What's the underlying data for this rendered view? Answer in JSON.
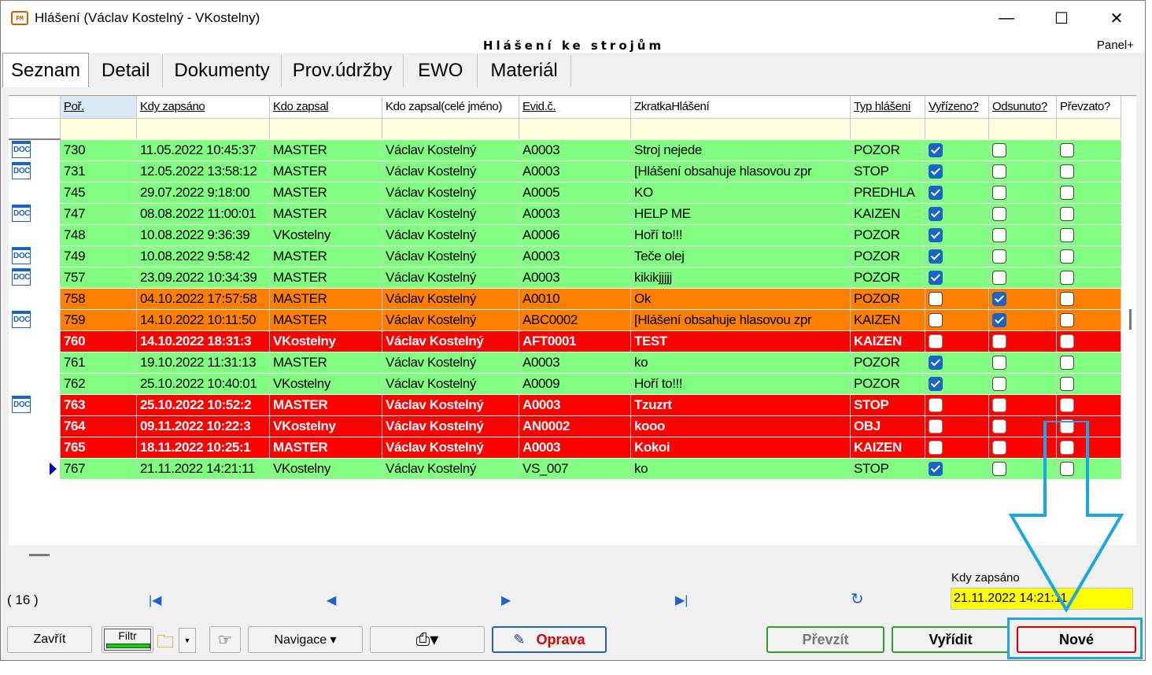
{
  "window": {
    "title": "Hlášení (Václav Kostelný - VKostelny)",
    "app_icon_text": "РМ",
    "module_title": "Hlášení ke strojům",
    "panel_link": "Panel+"
  },
  "tabs": [
    {
      "label": "Seznam",
      "active": true
    },
    {
      "label": "Detail"
    },
    {
      "label": "Dokumenty"
    },
    {
      "label": "Prov.údržby"
    },
    {
      "label": "EWO"
    },
    {
      "label": "Materiál"
    }
  ],
  "grid": {
    "columns": [
      "Poř.",
      "Kdy zapsáno",
      "Kdo zapsal",
      "Kdo zapsal(celé jméno)",
      "Evid.č.",
      "ZkratkaHlášení",
      "Typ hlášení",
      "Vyřízeno?",
      "Odsunuto?",
      "Převzato?"
    ],
    "doc_icon_text": "DOC",
    "rows": [
      {
        "por": "730",
        "kdy": "11.05.2022 10:45:37",
        "kdo": "MASTER",
        "jmeno": "Václav Kostelný",
        "evid": "A0003",
        "zkratka": "Stroj nejede",
        "typ": "POZOR",
        "vyrizeno": true,
        "odsunuto": false,
        "prevzato": false,
        "color": "green",
        "doc": true
      },
      {
        "por": "731",
        "kdy": "12.05.2022 13:58:12",
        "kdo": "MASTER",
        "jmeno": "Václav Kostelný",
        "evid": "A0003",
        "zkratka": "[Hlášení obsahuje hlasovou zpr",
        "typ": "STOP",
        "vyrizeno": true,
        "odsunuto": false,
        "prevzato": false,
        "color": "green",
        "doc": true
      },
      {
        "por": "745",
        "kdy": "29.07.2022 9:18:00",
        "kdo": "MASTER",
        "jmeno": "Václav Kostelný",
        "evid": "A0005",
        "zkratka": "KO",
        "typ": "PREDHLA",
        "vyrizeno": true,
        "odsunuto": false,
        "prevzato": false,
        "color": "green",
        "doc": false
      },
      {
        "por": "747",
        "kdy": "08.08.2022 11:00:01",
        "kdo": "MASTER",
        "jmeno": "Václav Kostelný",
        "evid": "A0003",
        "zkratka": "HELP ME",
        "typ": "KAIZEN",
        "vyrizeno": true,
        "odsunuto": false,
        "prevzato": false,
        "color": "green",
        "doc": true
      },
      {
        "por": "748",
        "kdy": "10.08.2022 9:36:39",
        "kdo": "VKostelny",
        "jmeno": "Václav Kostelný",
        "evid": "A0006",
        "zkratka": "Hoří to!!!",
        "typ": "POZOR",
        "vyrizeno": true,
        "odsunuto": false,
        "prevzato": false,
        "color": "green",
        "doc": false
      },
      {
        "por": "749",
        "kdy": "10.08.2022 9:58:42",
        "kdo": "MASTER",
        "jmeno": "Václav Kostelný",
        "evid": "A0003",
        "zkratka": "Teče olej",
        "typ": "POZOR",
        "vyrizeno": true,
        "odsunuto": false,
        "prevzato": false,
        "color": "green",
        "doc": true
      },
      {
        "por": "757",
        "kdy": "23.09.2022 10:34:39",
        "kdo": "MASTER",
        "jmeno": "Václav Kostelný",
        "evid": "A0003",
        "zkratka": "kikikjjjjj",
        "typ": "POZOR",
        "vyrizeno": true,
        "odsunuto": false,
        "prevzato": false,
        "color": "green",
        "doc": true
      },
      {
        "por": "758",
        "kdy": "04.10.2022 17:57:58",
        "kdo": "MASTER",
        "jmeno": "Václav Kostelný",
        "evid": "A0010",
        "zkratka": "Ok",
        "typ": "POZOR",
        "vyrizeno": false,
        "odsunuto": true,
        "prevzato": false,
        "color": "orange",
        "doc": false
      },
      {
        "por": "759",
        "kdy": "14.10.2022 10:11:50",
        "kdo": "MASTER",
        "jmeno": "Václav Kostelný",
        "evid": "ABC0002",
        "zkratka": "[Hlášení obsahuje hlasovou zpr",
        "typ": "KAIZEN",
        "vyrizeno": false,
        "odsunuto": true,
        "prevzato": false,
        "color": "orange",
        "doc": true
      },
      {
        "por": "760",
        "kdy": "14.10.2022 18:31:3",
        "kdo": "VKostelny",
        "jmeno": "Václav Kostelný",
        "evid": "AFT0001",
        "zkratka": "TEST",
        "typ": "KAIZEN",
        "vyrizeno": false,
        "odsunuto": false,
        "prevzato": false,
        "color": "red",
        "doc": false
      },
      {
        "por": "761",
        "kdy": "19.10.2022 11:31:13",
        "kdo": "MASTER",
        "jmeno": "Václav Kostelný",
        "evid": "A0003",
        "zkratka": "ko",
        "typ": "POZOR",
        "vyrizeno": true,
        "odsunuto": false,
        "prevzato": false,
        "color": "green",
        "doc": false
      },
      {
        "por": "762",
        "kdy": "25.10.2022 10:40:01",
        "kdo": "VKostelny",
        "jmeno": "Václav Kostelný",
        "evid": "A0009",
        "zkratka": "Hoří to!!!",
        "typ": "POZOR",
        "vyrizeno": true,
        "odsunuto": false,
        "prevzato": false,
        "color": "green",
        "doc": false
      },
      {
        "por": "763",
        "kdy": "25.10.2022 10:52:2",
        "kdo": "MASTER",
        "jmeno": "Václav Kostelný",
        "evid": "A0003",
        "zkratka": "Tzuzrt",
        "typ": "STOP",
        "vyrizeno": false,
        "odsunuto": false,
        "prevzato": false,
        "color": "red",
        "doc": true
      },
      {
        "por": "764",
        "kdy": "09.11.2022 10:22:3",
        "kdo": "VKostelny",
        "jmeno": "Václav Kostelný",
        "evid": "AN0002",
        "zkratka": "kooo",
        "typ": "OBJ",
        "vyrizeno": false,
        "odsunuto": false,
        "prevzato": false,
        "color": "red",
        "doc": false
      },
      {
        "por": "765",
        "kdy": "18.11.2022 10:25:1",
        "kdo": "MASTER",
        "jmeno": "Václav Kostelný",
        "evid": "A0003",
        "zkratka": "Kokoi",
        "typ": "KAIZEN",
        "vyrizeno": false,
        "odsunuto": false,
        "prevzato": false,
        "color": "red",
        "doc": false
      },
      {
        "por": "767",
        "kdy": "21.11.2022 14:21:11",
        "kdo": "VKostelny",
        "jmeno": "Václav Kostelný",
        "evid": "VS_007",
        "zkratka": "ko",
        "typ": "STOP",
        "vyrizeno": true,
        "odsunuto": false,
        "prevzato": false,
        "color": "green",
        "doc": false,
        "current": true
      }
    ]
  },
  "status": {
    "count": "( 16 )",
    "kdy_label": "Kdy zapsáno",
    "kdy_value": "21.11.2022 14:21:11"
  },
  "toolbar": {
    "zavrit": "Zavřít",
    "filtr": "Filtr",
    "navigace": "Navigace ▾",
    "oprava": "Oprava",
    "prevzit": "Převzít",
    "vyridit": "Vyřídit",
    "nove": "Nové"
  },
  "colors": {
    "row_green": "#80ff80",
    "row_orange": "#ff8000",
    "row_red": "#ff0000",
    "kdy_field": "#ffff00",
    "annotation": "#1ca7e2"
  }
}
